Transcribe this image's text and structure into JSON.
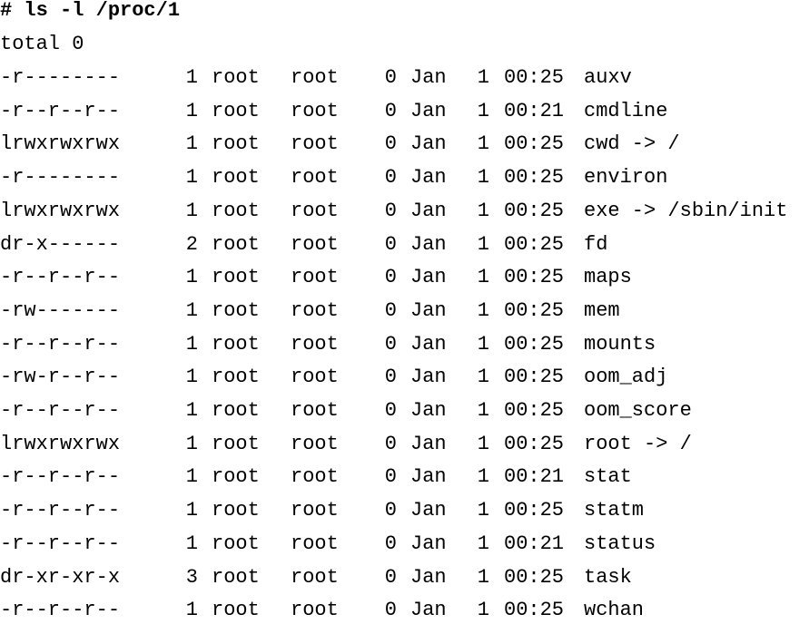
{
  "terminal": {
    "prompt": "# ",
    "command": "ls -l /proc/1",
    "total": "total 0",
    "entries": [
      {
        "perm": "-r--------",
        "links": "1",
        "owner": "root",
        "group": "root",
        "size": "0",
        "month": "Jan",
        "day": "1",
        "time": "00:25",
        "name": "auxv"
      },
      {
        "perm": "-r--r--r--",
        "links": "1",
        "owner": "root",
        "group": "root",
        "size": "0",
        "month": "Jan",
        "day": "1",
        "time": "00:21",
        "name": "cmdline"
      },
      {
        "perm": "lrwxrwxrwx",
        "links": "1",
        "owner": "root",
        "group": "root",
        "size": "0",
        "month": "Jan",
        "day": "1",
        "time": "00:25",
        "name": "cwd -> /"
      },
      {
        "perm": "-r--------",
        "links": "1",
        "owner": "root",
        "group": "root",
        "size": "0",
        "month": "Jan",
        "day": "1",
        "time": "00:25",
        "name": "environ"
      },
      {
        "perm": "lrwxrwxrwx",
        "links": "1",
        "owner": "root",
        "group": "root",
        "size": "0",
        "month": "Jan",
        "day": "1",
        "time": "00:25",
        "name": "exe -> /sbin/init"
      },
      {
        "perm": "dr-x------",
        "links": "2",
        "owner": "root",
        "group": "root",
        "size": "0",
        "month": "Jan",
        "day": "1",
        "time": "00:25",
        "name": "fd"
      },
      {
        "perm": "-r--r--r--",
        "links": "1",
        "owner": "root",
        "group": "root",
        "size": "0",
        "month": "Jan",
        "day": "1",
        "time": "00:25",
        "name": "maps"
      },
      {
        "perm": "-rw-------",
        "links": "1",
        "owner": "root",
        "group": "root",
        "size": "0",
        "month": "Jan",
        "day": "1",
        "time": "00:25",
        "name": "mem"
      },
      {
        "perm": "-r--r--r--",
        "links": "1",
        "owner": "root",
        "group": "root",
        "size": "0",
        "month": "Jan",
        "day": "1",
        "time": "00:25",
        "name": "mounts"
      },
      {
        "perm": "-rw-r--r--",
        "links": "1",
        "owner": "root",
        "group": "root",
        "size": "0",
        "month": "Jan",
        "day": "1",
        "time": "00:25",
        "name": "oom_adj"
      },
      {
        "perm": "-r--r--r--",
        "links": "1",
        "owner": "root",
        "group": "root",
        "size": "0",
        "month": "Jan",
        "day": "1",
        "time": "00:25",
        "name": "oom_score"
      },
      {
        "perm": "lrwxrwxrwx",
        "links": "1",
        "owner": "root",
        "group": "root",
        "size": "0",
        "month": "Jan",
        "day": "1",
        "time": "00:25",
        "name": "root -> /"
      },
      {
        "perm": "-r--r--r--",
        "links": "1",
        "owner": "root",
        "group": "root",
        "size": "0",
        "month": "Jan",
        "day": "1",
        "time": "00:21",
        "name": "stat"
      },
      {
        "perm": "-r--r--r--",
        "links": "1",
        "owner": "root",
        "group": "root",
        "size": "0",
        "month": "Jan",
        "day": "1",
        "time": "00:25",
        "name": "statm"
      },
      {
        "perm": "-r--r--r--",
        "links": "1",
        "owner": "root",
        "group": "root",
        "size": "0",
        "month": "Jan",
        "day": "1",
        "time": "00:21",
        "name": "status"
      },
      {
        "perm": "dr-xr-xr-x",
        "links": "3",
        "owner": "root",
        "group": "root",
        "size": "0",
        "month": "Jan",
        "day": "1",
        "time": "00:25",
        "name": "task"
      },
      {
        "perm": "-r--r--r--",
        "links": "1",
        "owner": "root",
        "group": "root",
        "size": "0",
        "month": "Jan",
        "day": "1",
        "time": "00:25",
        "name": "wchan"
      }
    ]
  }
}
